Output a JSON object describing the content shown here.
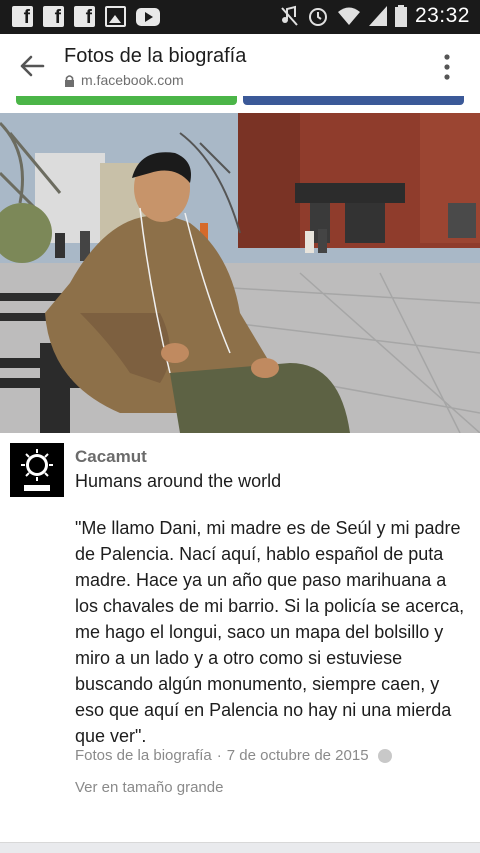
{
  "status_bar": {
    "time": "23:32",
    "left_icons": [
      "facebook-icon",
      "facebook-icon",
      "facebook-icon",
      "image-icon",
      "youtube-icon"
    ],
    "right_icons": [
      "mute-icon",
      "alarm-icon",
      "wifi-icon",
      "signal-icon",
      "battery-icon"
    ]
  },
  "app_bar": {
    "title": "Fotos de la biografía",
    "url": "m.facebook.com"
  },
  "post": {
    "author": "Cacamut",
    "headline": "Humans around the world",
    "body": "\"Me llamo Dani, mi madre es de Seúl y mi padre de Palencia. Nací aquí, hablo español de puta madre. Hace ya un año que paso marihuana a los chavales de mi barrio. Si la policía se acerca, me hago el longui, saco un mapa del bolsillo y miro a un lado y a otro como si estuviese buscando algún monumento, siempre caen, y eso que aquí en Palencia no hay ni una mierda que ver\".",
    "album": "Fotos de la biografía",
    "separator": "·",
    "date": "7 de octubre de 2015",
    "view_large": "Ver en tamaño grande"
  },
  "colors": {
    "green_bar": "#4bb548",
    "blue_bar": "#3b5998"
  }
}
